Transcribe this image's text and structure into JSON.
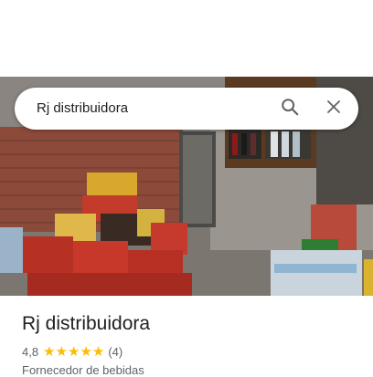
{
  "search": {
    "query": "Rj distribuidora",
    "search_icon": "search-icon",
    "clear_icon": "close-icon"
  },
  "photo": {
    "subject": "store-interior-photo"
  },
  "place": {
    "name": "Rj distribuidora",
    "rating": "4,8",
    "stars": 5,
    "review_count": "(4)",
    "category": "Fornecedor de bebidas"
  },
  "colors": {
    "star": "#fbbc04",
    "title_text": "#202124",
    "secondary_text": "#5f6368"
  }
}
